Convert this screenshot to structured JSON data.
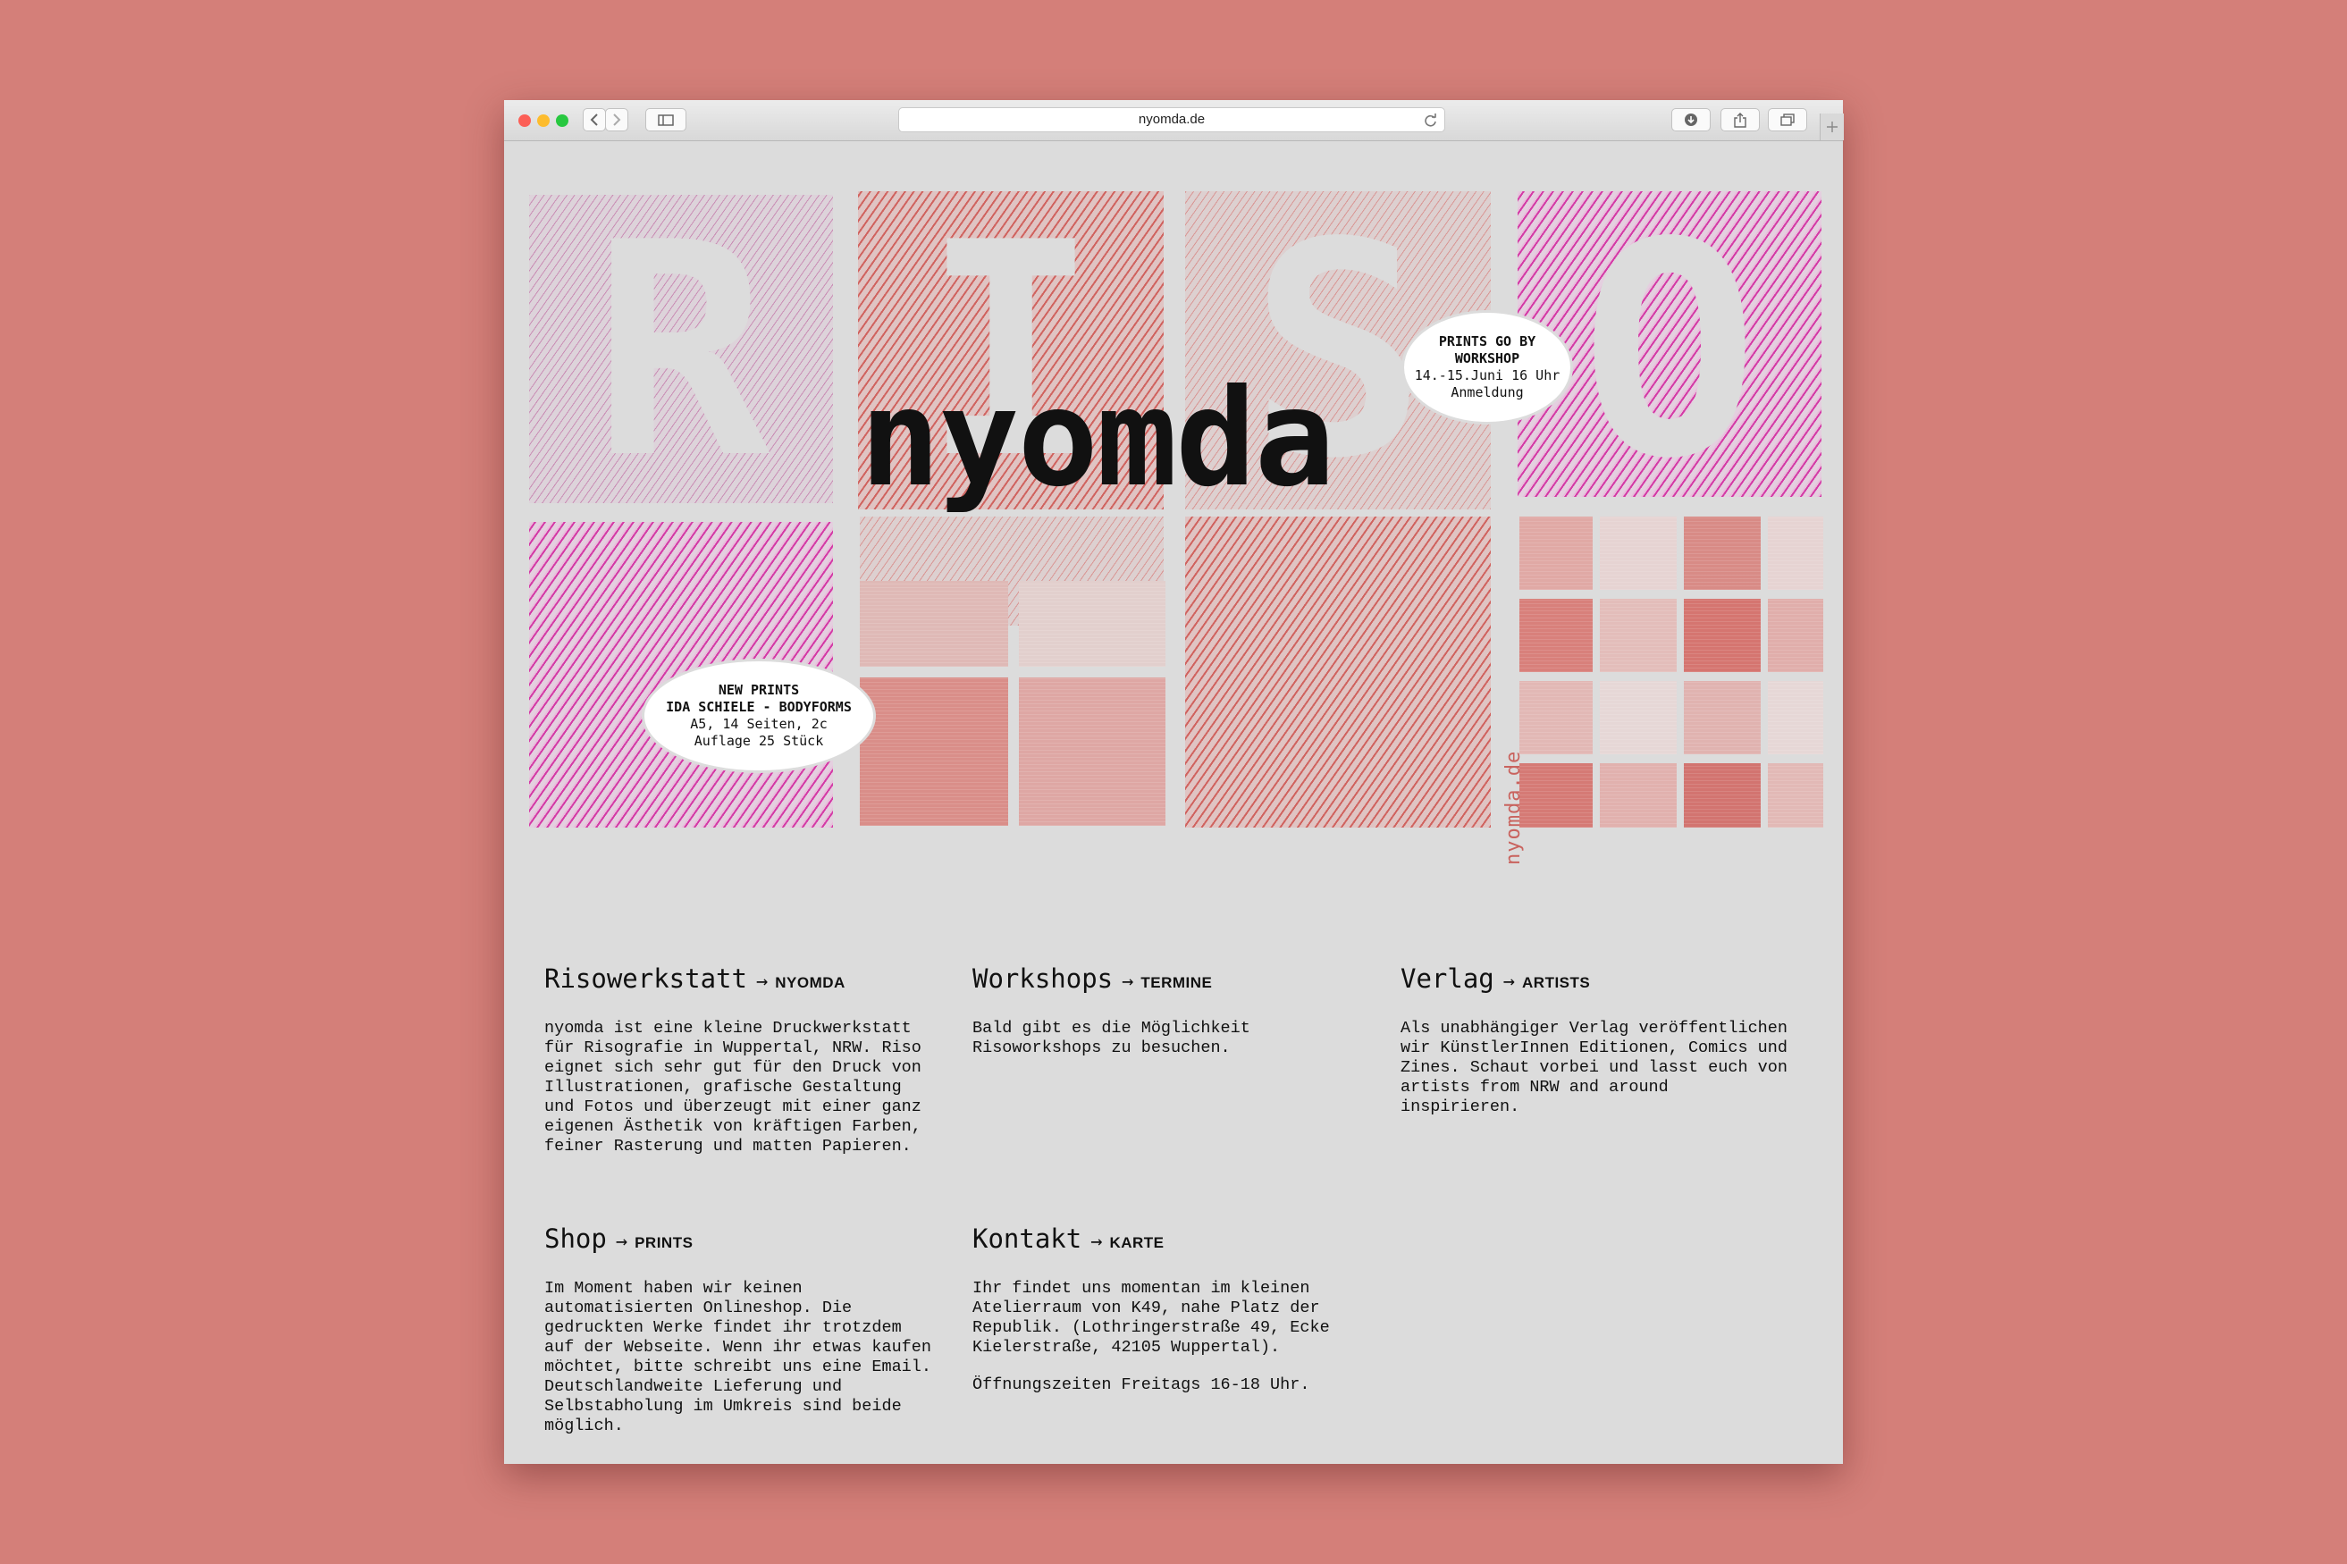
{
  "browser": {
    "url": "nyomda.de",
    "icons": {
      "back": "chevron-left-icon",
      "forward": "chevron-right-icon",
      "sidebar": "sidebar-icon",
      "reload": "reload-icon",
      "download": "download-icon",
      "share": "share-icon",
      "tabs": "tabs-icon",
      "new_tab": "plus-icon"
    }
  },
  "colors": {
    "background": "#d47f79",
    "page": "#dcdcdc",
    "pink": "#d43aa6",
    "red": "#d0635f"
  },
  "hero": {
    "letters": [
      "R",
      "I",
      "S",
      "O"
    ],
    "logo": "nyomda",
    "side_text": "nyomda.de"
  },
  "bubbles": {
    "workshop": {
      "line1": "PRINTS GO BY",
      "line2": "WORKSHOP",
      "line3": "14.-15.Juni 16 Uhr",
      "line4": "Anmeldung"
    },
    "new_prints": {
      "line1": "NEW PRINTS",
      "line2": "IDA SCHIELE - BODYFORMS",
      "line3": "A5, 14 Seiten, 2c",
      "line4": "Auflage 25 Stück"
    }
  },
  "sections": {
    "risowerkstatt": {
      "title": "Risowerkstatt",
      "arrow": "→",
      "link": "NYOMDA",
      "text": "nyomda ist eine kleine Druckwerkstatt\nfür Risografie in Wuppertal, NRW. Riso\neignet sich sehr gut für den Druck von\nIllustrationen, grafische Gestaltung\nund Fotos und überzeugt mit einer ganz\neigenen Ästhetik von kräftigen Farben,\nfeiner Rasterung und matten Papieren."
    },
    "workshops": {
      "title": "Workshops",
      "arrow": "→",
      "link": "TERMINE",
      "text": "Bald gibt es die Möglichkeit\nRisoworkshops zu besuchen."
    },
    "verlag": {
      "title": "Verlag",
      "arrow": "→",
      "link": "ARTISTS",
      "text": "Als unabhängiger Verlag veröffentlichen\nwir KünstlerInnen Editionen, Comics und\nZines. Schaut vorbei und lasst euch von\nartists from NRW and around\ninspirieren."
    },
    "shop": {
      "title": "Shop",
      "arrow": "→",
      "link": "PRINTS",
      "text": "Im Moment haben wir keinen\nautomatisierten Onlineshop. Die\ngedruckten Werke findet ihr trotzdem\nauf der Webseite. Wenn ihr etwas kaufen\nmöchtet, bitte schreibt uns eine Email.\nDeutschlandweite Lieferung und\nSelbstabholung im Umkreis sind beide\nmöglich."
    },
    "kontakt": {
      "title": "Kontakt",
      "arrow": "→",
      "link": "KARTE",
      "text": "Ihr findet uns momentan im kleinen\nAtelierraum von K49, nahe Platz der\nRepublik. (Lothringerstraße 49, Ecke\nKielerstraße, 42105 Wuppertal).",
      "hours": "Öffnungszeiten Freitags 16-18 Uhr."
    }
  }
}
